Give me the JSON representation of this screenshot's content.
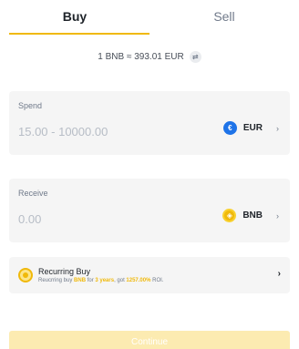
{
  "tabs": {
    "buy": "Buy",
    "sell": "Sell",
    "active": "Buy"
  },
  "rate": {
    "text": "1 BNB ≈ 393.01 EUR",
    "icon": "refresh-icon"
  },
  "spend": {
    "label": "Spend",
    "placeholder": "15.00 - 10000.00",
    "currency": "EUR",
    "currency_icon_glyph": "€",
    "currency_color": "#1E73E8"
  },
  "receive": {
    "label": "Receive",
    "placeholder": "0.00",
    "currency": "BNB",
    "currency_icon_glyph": "◈",
    "currency_color": "#F0B90B"
  },
  "recurring": {
    "title": "Recurring Buy",
    "sub_prefix": "Reucrring buy ",
    "sub_coin": "BNB",
    "sub_mid": " for ",
    "sub_years": "3 years",
    "sub_mid2": ", got ",
    "sub_roi": "1257.00%",
    "sub_suffix": " ROI."
  },
  "continue": {
    "label": "Continue"
  },
  "colors": {
    "accent": "#F0B90B",
    "text": "#1E2329",
    "muted": "#707A8A",
    "card": "#F5F5F5"
  }
}
